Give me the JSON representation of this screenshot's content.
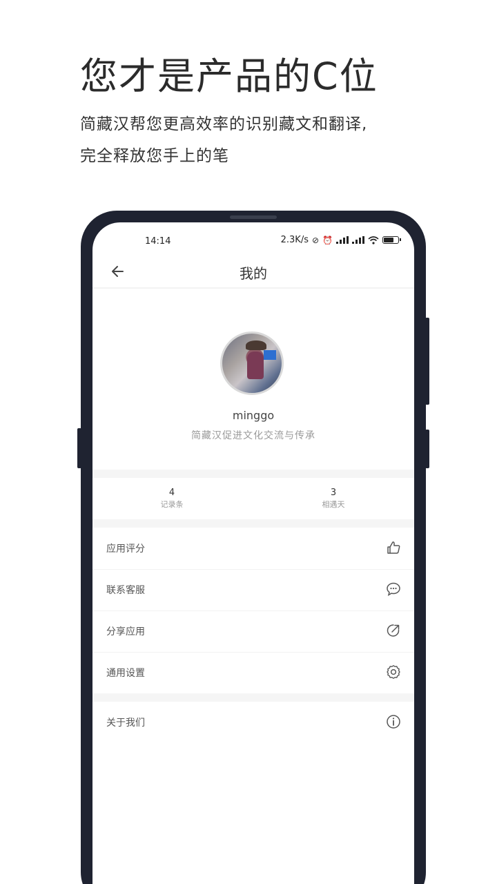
{
  "headline": "您才是产品的C位",
  "subline_1": "简藏汉帮您更高效率的识别藏文和翻译,",
  "subline_2": "完全释放您手上的笔",
  "status_bar": {
    "time": "14:14",
    "speed": "2.3K/s"
  },
  "nav": {
    "title": "我的",
    "back_icon": "back-arrow-icon"
  },
  "profile": {
    "username": "minggo",
    "tagline": "简藏汉促进文化交流与传承"
  },
  "stats": [
    {
      "value": "4",
      "label": "记录条"
    },
    {
      "value": "3",
      "label": "相遇天"
    }
  ],
  "menu": [
    {
      "label": "应用评分",
      "icon": "thumbs-up-icon"
    },
    {
      "label": "联系客服",
      "icon": "chat-bubble-icon"
    },
    {
      "label": "分享应用",
      "icon": "share-icon"
    },
    {
      "label": "通用设置",
      "icon": "gear-icon"
    },
    {
      "label": "关于我们",
      "icon": "info-icon"
    }
  ]
}
